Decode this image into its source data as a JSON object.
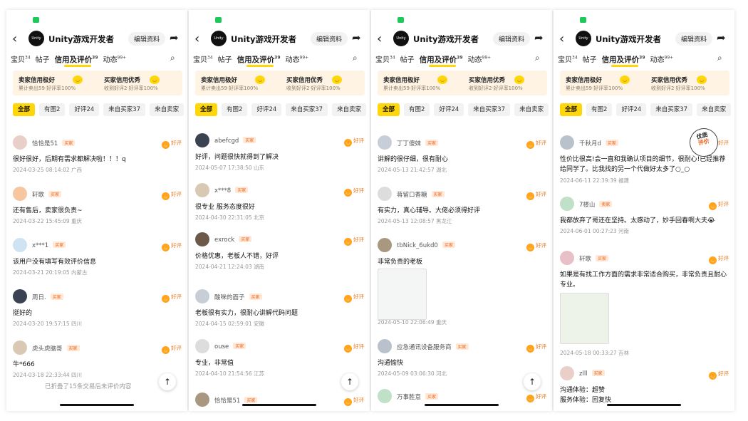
{
  "header": {
    "shop_name": "Unity游戏开发者",
    "logo_text": "Unity",
    "edit_label": "编辑资料"
  },
  "tabs": [
    {
      "label": "宝贝",
      "count": "34"
    },
    {
      "label": "帖子",
      "count": ""
    },
    {
      "label": "信用及评价",
      "count": "39"
    },
    {
      "label": "动态",
      "count": "99+"
    }
  ],
  "credit": {
    "seller_title": "卖家信用极好",
    "seller_sub": "累计卖出59·好评率100%",
    "buyer_title": "买家信用优秀",
    "buyer_sub": "收到好评2·好评率100%"
  },
  "filters": [
    "全部",
    "有图2",
    "好评24",
    "来自买家37",
    "来自卖家"
  ],
  "good_label": "好评",
  "badges": {
    "buyer": "买家",
    "seller": "卖家"
  },
  "panels": [
    {
      "reviews": [
        {
          "name": "恰恰是51",
          "badge": "买家",
          "text": "很好很好，后期有需求都解决啦！！！q",
          "meta": "2024-03-25 08:14:02 广西"
        },
        {
          "name": "轩歌",
          "badge": "买家",
          "text": "还有售后，卖家很负责~",
          "meta": "2024-03-22 15:45:09 重庆"
        },
        {
          "name": "x***1",
          "badge": "买家",
          "text": "该用户没有填写有效评价信息",
          "meta": "2024-03-21 20:19:05 内蒙古"
        },
        {
          "name": "周日.",
          "badge": "买家",
          "text": "挺好的",
          "meta": "2024-03-20 19:57:15 四川"
        },
        {
          "name": "虎头虎脑哥",
          "badge": "买家",
          "text": "牛*666",
          "meta": "2024-03-18 22:33:44 四川"
        }
      ],
      "footer": "已折叠了15条交易后未评价内容"
    },
    {
      "reviews": [
        {
          "name": "abefcgd",
          "badge": "买家",
          "text": "好评，问题很快就得到了解决",
          "meta": "2024-05-07 17:38:50 山东"
        },
        {
          "name": "x***8",
          "badge": "买家",
          "text": "很专业 服务态度很好",
          "meta": "2024-04-30 22:31:05 北京"
        },
        {
          "name": "exrock",
          "badge": "买家",
          "text": "价格优惠，老板人不错，好评",
          "meta": "2024-04-21 12:24:03 湖南"
        },
        {
          "name": "酸咪的面子",
          "badge": "买家",
          "text": "老板很有实力，很耐心讲解代码问题",
          "meta": "2024-04-15 02:59:01 安徽"
        },
        {
          "name": "ouse",
          "badge": "买家",
          "text": "专业，非常值",
          "meta": "2024-04-10 21:54:56 江苏"
        },
        {
          "name": "恰恰是51",
          "badge": "买家",
          "text": "",
          "meta": ""
        }
      ]
    },
    {
      "reviews": [
        {
          "name": "丁丁傻妹",
          "badge": "买家",
          "text": "讲解的很仔细，很有耐心",
          "meta": "2024-05-13 21:42:57 湖北"
        },
        {
          "name": "蒋留口香糖",
          "badge": "买家",
          "text": "有实力，真心辅导。大佬必须得好评",
          "meta": "2024-05-13 12:08:57 黑龙江"
        },
        {
          "name": "tbNick_6ukd0",
          "badge": "买家",
          "text": "非常负责的老板",
          "meta": "2024-05-10 22:06:49 重庆"
        },
        {
          "name": "应急通讯设备服务商",
          "badge": "买家",
          "text": "沟通愉快",
          "meta": "2024-05-09 03:06:30 河北"
        },
        {
          "name": "万事胜意",
          "badge": "买家",
          "text": "",
          "meta": ""
        }
      ]
    },
    {
      "stamp": [
        "优质",
        "评价"
      ],
      "reviews": [
        {
          "name": "千秋月d",
          "badge": "买家",
          "text": "性价比很高!会一直和我确认项目的细节，很耐心!已经推荐给同学了。比我找的另一个代做好太多了○_○",
          "meta": "2024-06-11 22:39:39 福建"
        },
        {
          "name": "7楼山",
          "badge": "卖家",
          "text": "我都放弃了哥还在坚持。太感动了，妙手回春啊大夫😭",
          "meta": "2024-06-01 00:27:23 河南"
        },
        {
          "name": "轩歌",
          "badge": "买家",
          "text": "如果是有找工作方面的需求非常适合购买，非常负责且耐心专业。",
          "meta": "2024-05-18 00:33:27 吉林"
        },
        {
          "name": "zlll",
          "badge": "买家",
          "text": "沟通体验：超赞",
          "text2": "服务体验：回复快",
          "meta": ""
        }
      ]
    }
  ],
  "colors": {
    "accent": "#ffd60a",
    "badge": "#f0641e",
    "credit_bg": "#fff3e4"
  }
}
